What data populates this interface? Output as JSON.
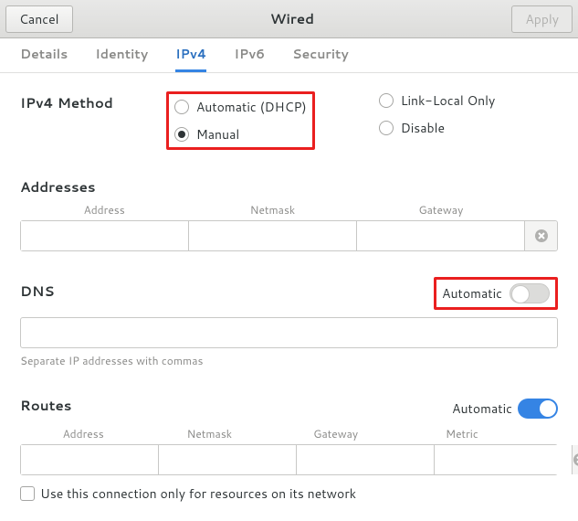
{
  "header": {
    "cancel": "Cancel",
    "title": "Wired",
    "apply": "Apply"
  },
  "tabs": {
    "details": "Details",
    "identity": "Identity",
    "ipv4": "IPv4",
    "ipv6": "IPv6",
    "security": "Security",
    "active": "ipv4"
  },
  "method": {
    "label": "IPv4 Method",
    "automatic": "Automatic (DHCP)",
    "manual": "Manual",
    "linklocal": "Link-Local Only",
    "disable": "Disable",
    "selected": "manual"
  },
  "addresses": {
    "heading": "Addresses",
    "cols": {
      "address": "Address",
      "netmask": "Netmask",
      "gateway": "Gateway"
    }
  },
  "dns": {
    "heading": "DNS",
    "automatic_label": "Automatic",
    "automatic_on": false,
    "hint": "Separate IP addresses with commas"
  },
  "routes": {
    "heading": "Routes",
    "automatic_label": "Automatic",
    "automatic_on": true,
    "cols": {
      "address": "Address",
      "netmask": "Netmask",
      "gateway": "Gateway",
      "metric": "Metric"
    },
    "restrict": "Use this connection only for resources on its network"
  }
}
